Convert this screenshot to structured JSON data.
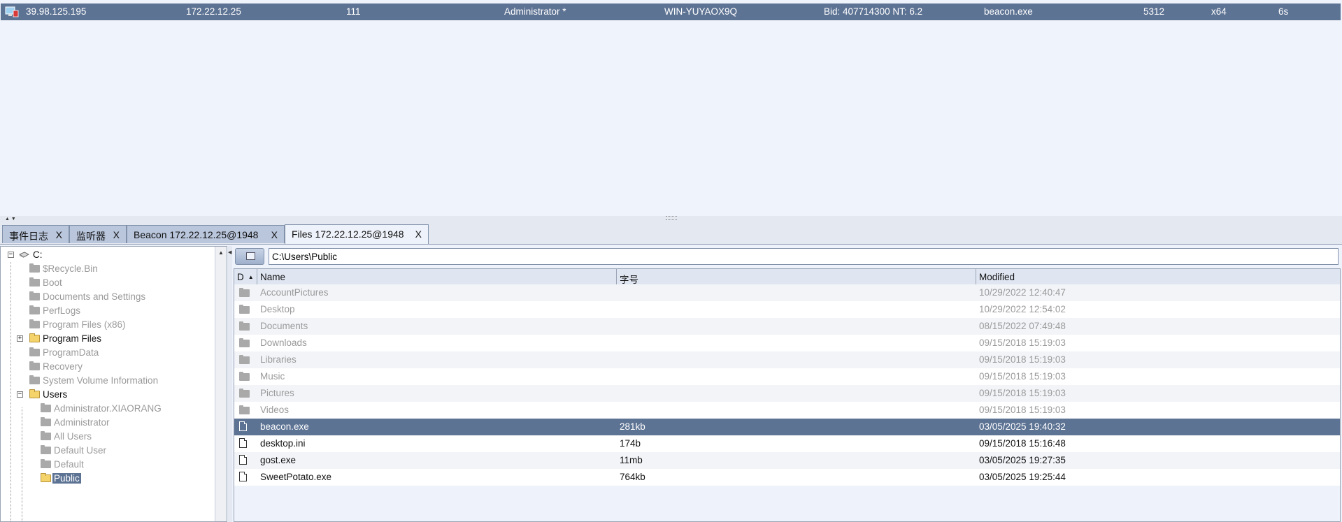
{
  "sessions": {
    "rows": [
      {
        "external": "39.98.125.195",
        "internal": "172.22.12.25",
        "listener": "111",
        "user": "Administrator *",
        "computer": "WIN-YUYAOX9Q",
        "note": "Bid: 407714300  NT: 6.2",
        "process": "beacon.exe",
        "pid": "5312",
        "arch": "x64",
        "last": "6s"
      }
    ]
  },
  "tabs": [
    {
      "label": "事件日志",
      "close": "X"
    },
    {
      "label": "监听器",
      "close": "X"
    },
    {
      "label": "Beacon 172.22.12.25@1948",
      "close": "X"
    },
    {
      "label": "Files 172.22.12.25@1948",
      "close": "X",
      "active": true
    }
  ],
  "tree": {
    "root": "C:",
    "expander_collapsed": "+",
    "expander_expanded": "−",
    "items": [
      {
        "label": "$Recycle.Bin"
      },
      {
        "label": "Boot"
      },
      {
        "label": "Documents and Settings"
      },
      {
        "label": "PerfLogs"
      },
      {
        "label": "Program Files (x86)"
      },
      {
        "label": "Program Files"
      },
      {
        "label": "ProgramData"
      },
      {
        "label": "Recovery"
      },
      {
        "label": "System Volume Information"
      },
      {
        "label": "Users"
      },
      {
        "label": "Administrator.XIAORANG"
      },
      {
        "label": "Administrator"
      },
      {
        "label": "All Users"
      },
      {
        "label": "Default User"
      },
      {
        "label": "Default"
      },
      {
        "label": "Public"
      }
    ]
  },
  "files": {
    "path": "C:\\Users\\Public",
    "columns": {
      "d": "D",
      "name": "Name",
      "size": "字号",
      "modified": "Modified"
    },
    "rows": [
      {
        "name": "AccountPictures",
        "size": "",
        "modified": "10/29/2022 12:40:47"
      },
      {
        "name": "Desktop",
        "size": "",
        "modified": "10/29/2022 12:54:02"
      },
      {
        "name": "Documents",
        "size": "",
        "modified": "08/15/2022 07:49:48"
      },
      {
        "name": "Downloads",
        "size": "",
        "modified": "09/15/2018 15:19:03"
      },
      {
        "name": "Libraries",
        "size": "",
        "modified": "09/15/2018 15:19:03"
      },
      {
        "name": "Music",
        "size": "",
        "modified": "09/15/2018 15:19:03"
      },
      {
        "name": "Pictures",
        "size": "",
        "modified": "09/15/2018 15:19:03"
      },
      {
        "name": "Videos",
        "size": "",
        "modified": "09/15/2018 15:19:03"
      },
      {
        "name": "beacon.exe",
        "size": "281kb",
        "modified": "03/05/2025 19:40:32"
      },
      {
        "name": "desktop.ini",
        "size": "174b",
        "modified": "09/15/2018 15:16:48"
      },
      {
        "name": "gost.exe",
        "size": "11mb",
        "modified": "03/05/2025 19:27:35"
      },
      {
        "name": "SweetPotato.exe",
        "size": "764kb",
        "modified": "03/05/2025 19:25:44"
      }
    ]
  },
  "colors": {
    "selection": "#5d7394",
    "background": "#eef2fa",
    "folder_yellow": "#f4d36b",
    "folder_gray": "#a9a9a9"
  }
}
